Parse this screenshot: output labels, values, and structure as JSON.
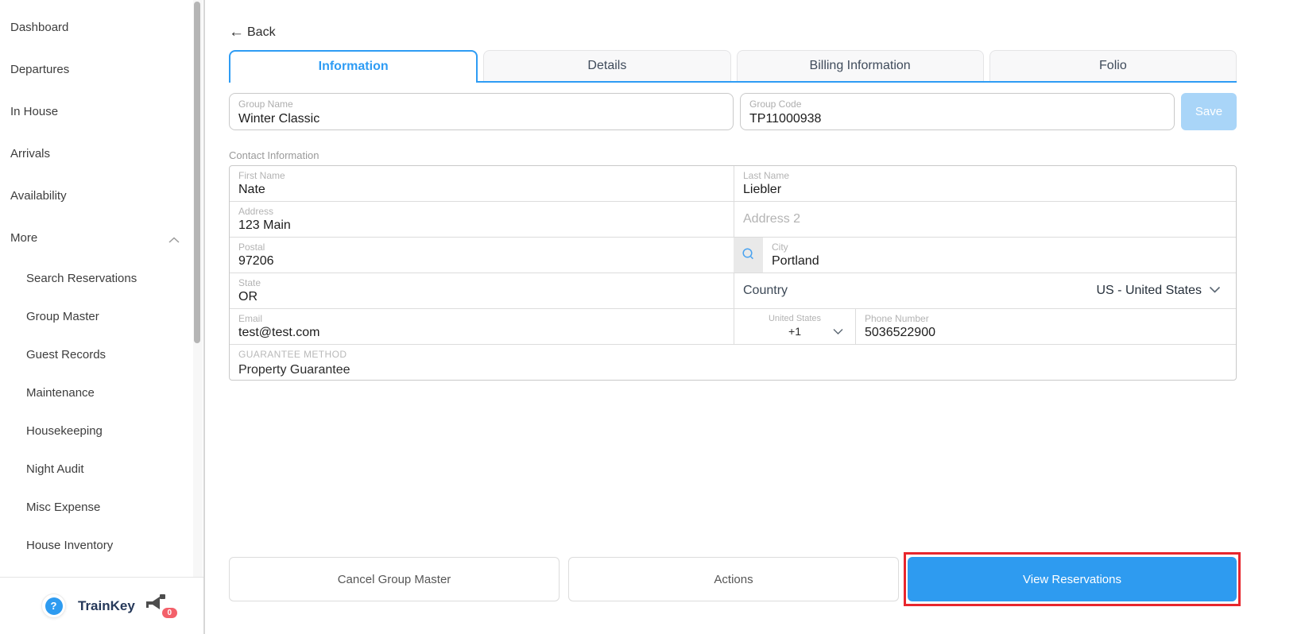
{
  "sidebar": {
    "items": [
      "Dashboard",
      "Departures",
      "In House",
      "Arrivals",
      "Availability",
      "More"
    ],
    "sub": [
      "Search Reservations",
      "Group Master",
      "Guest Records",
      "Maintenance",
      "Housekeeping",
      "Night Audit",
      "Misc Expense",
      "House Inventory"
    ],
    "footer": {
      "help": "?",
      "brand": "TrainKey",
      "badge_count": "0"
    }
  },
  "header": {
    "back_label": "Back"
  },
  "tabs": [
    {
      "label": "Information",
      "active": true
    },
    {
      "label": "Details",
      "active": false
    },
    {
      "label": "Billing Information",
      "active": false
    },
    {
      "label": "Folio",
      "active": false
    }
  ],
  "group": {
    "name_label": "Group Name",
    "name_value": "Winter Classic",
    "code_label": "Group Code",
    "code_value": "TP11000938",
    "save_label": "Save"
  },
  "contact": {
    "section_label": "Contact Information",
    "first_name": {
      "label": "First Name",
      "value": "Nate"
    },
    "last_name": {
      "label": "Last Name",
      "value": "Liebler"
    },
    "address": {
      "label": "Address",
      "value": "123 Main"
    },
    "address2": {
      "placeholder": "Address 2"
    },
    "postal": {
      "label": "Postal",
      "value": "97206"
    },
    "city": {
      "label": "City",
      "value": "Portland"
    },
    "state": {
      "label": "State",
      "value": "OR"
    },
    "country": {
      "label": "Country",
      "value": "US - United States"
    },
    "email": {
      "label": "Email",
      "value": "test@test.com"
    },
    "phone": {
      "country_label": "United States",
      "dial_code": "+1",
      "label": "Phone Number",
      "value": "5036522900"
    },
    "guarantee": {
      "label": "GUARANTEE METHOD",
      "value": "Property Guarantee"
    }
  },
  "actions": [
    "Cancel Group Master",
    "Actions",
    "View Reservations"
  ],
  "colors": {
    "accent_blue": "#2e9cf4",
    "primary_button_blue": "#2e9bf0",
    "save_disabled_blue": "#a9d5f8",
    "annotation_red": "#e8262d",
    "badge_red": "#f3606a",
    "brand_navy": "#26395a"
  }
}
